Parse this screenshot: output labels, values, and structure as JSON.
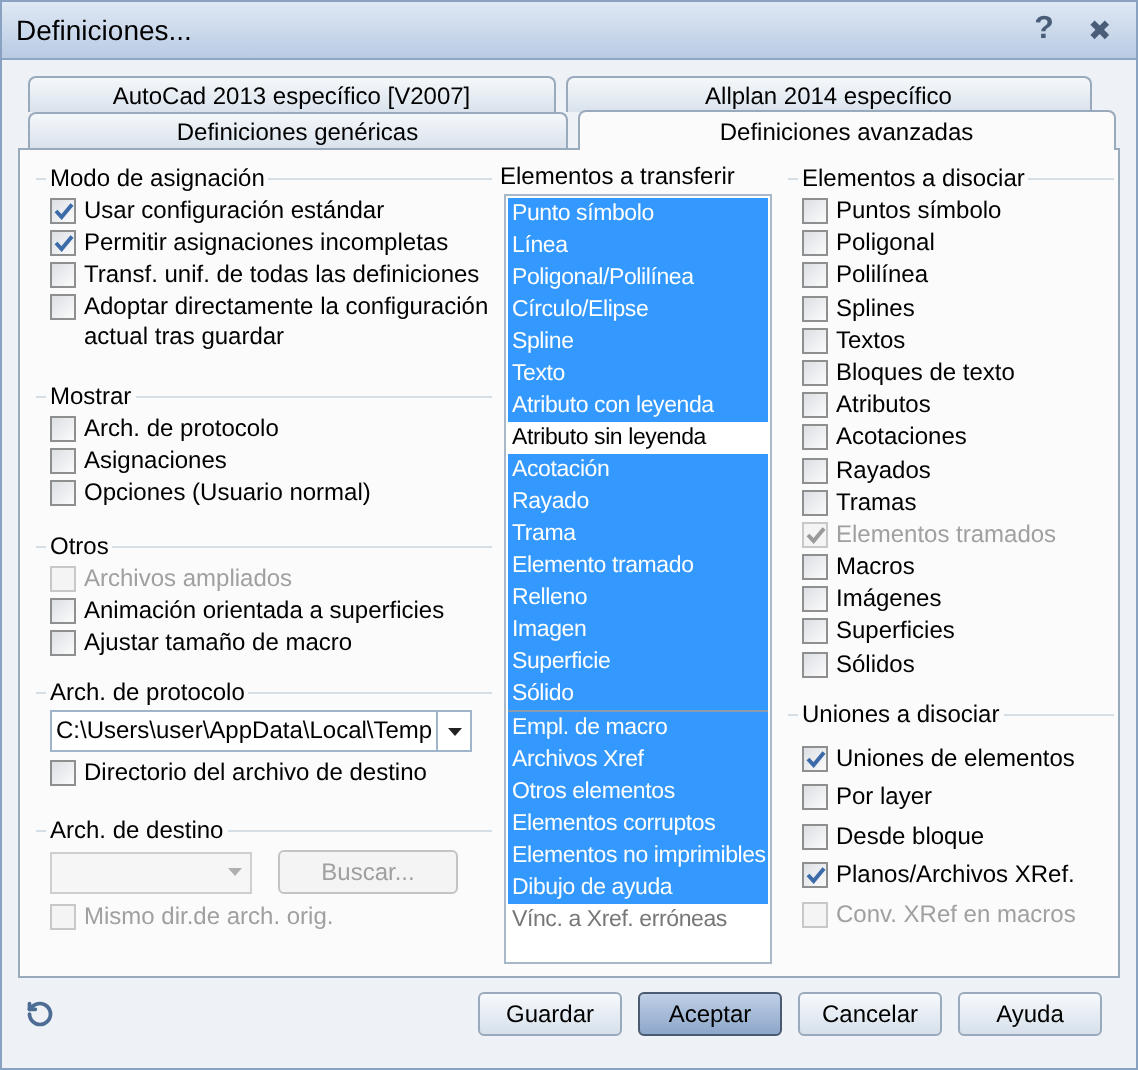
{
  "window": {
    "title": "Definiciones...",
    "help_glyph": "?",
    "close_glyph": "✖"
  },
  "tabs": [
    [
      {
        "label": "AutoCad 2013 específico [V2007]",
        "selected": false
      },
      {
        "label": "Allplan 2014 específico",
        "selected": false
      }
    ],
    [
      {
        "label": "Definiciones genéricas",
        "selected": false
      },
      {
        "label": "Definiciones avanzadas",
        "selected": true
      }
    ]
  ],
  "modo_asignacion": {
    "title": "Modo de asignación",
    "options": [
      {
        "label": "Usar configuración estándar",
        "checked": true,
        "disabled": false
      },
      {
        "label": "Permitir asignaciones incompletas",
        "checked": true,
        "disabled": false
      },
      {
        "label": "Transf. unif. de todas las definiciones",
        "checked": false,
        "disabled": false
      },
      {
        "label": "Adoptar directamente la configuración actual tras guardar",
        "checked": false,
        "disabled": false
      }
    ]
  },
  "mostrar": {
    "title": "Mostrar",
    "options": [
      {
        "label": "Arch. de protocolo",
        "checked": false,
        "disabled": false
      },
      {
        "label": "Asignaciones",
        "checked": false,
        "disabled": false
      },
      {
        "label": "Opciones (Usuario normal)",
        "checked": false,
        "disabled": false
      }
    ]
  },
  "otros": {
    "title": "Otros",
    "options": [
      {
        "label": "Archivos ampliados",
        "checked": false,
        "disabled": true
      },
      {
        "label": "Animación orientada a superficies",
        "checked": false,
        "disabled": false
      },
      {
        "label": "Ajustar tamaño de macro",
        "checked": false,
        "disabled": false
      }
    ]
  },
  "arch_protocolo": {
    "title": "Arch. de protocolo",
    "path": "C:\\Users\\user\\AppData\\Local\\Temp",
    "options": [
      {
        "label": "Directorio del archivo de destino",
        "checked": false,
        "disabled": false
      }
    ]
  },
  "arch_destino": {
    "title": "Arch. de destino",
    "combo": {
      "disabled": true
    },
    "browse_button": {
      "label": "Buscar...",
      "disabled": true
    },
    "options": [
      {
        "label": "Mismo dir.de arch. orig.",
        "checked": false,
        "disabled": true
      }
    ]
  },
  "transferir": {
    "title": "Elementos a transferir",
    "groups": [
      [
        {
          "label": "Punto símbolo",
          "selected": true
        },
        {
          "label": "Línea",
          "selected": true
        },
        {
          "label": "Poligonal/Polilínea",
          "selected": true
        },
        {
          "label": "Círculo/Elipse",
          "selected": true
        },
        {
          "label": "Spline",
          "selected": true
        },
        {
          "label": "Texto",
          "selected": true
        },
        {
          "label": "Atributo con leyenda",
          "selected": true
        },
        {
          "label": "Atributo sin leyenda",
          "selected": false
        },
        {
          "label": "Acotación",
          "selected": true
        },
        {
          "label": "Rayado",
          "selected": true
        },
        {
          "label": "Trama",
          "selected": true
        },
        {
          "label": "Elemento tramado",
          "selected": true
        },
        {
          "label": "Relleno",
          "selected": true
        },
        {
          "label": "Imagen",
          "selected": true
        },
        {
          "label": "Superficie",
          "selected": true
        },
        {
          "label": "Sólido",
          "selected": true
        }
      ],
      [
        {
          "label": "Empl. de macro",
          "selected": true
        },
        {
          "label": "Archivos Xref",
          "selected": true
        },
        {
          "label": "Otros elementos",
          "selected": true
        },
        {
          "label": "Elementos corruptos",
          "selected": true
        },
        {
          "label": "Elementos no imprimibles",
          "selected": true
        },
        {
          "label": "Dibujo de ayuda",
          "selected": true
        },
        {
          "label": "Vínc. a Xref. erróneas",
          "selected": false
        }
      ]
    ]
  },
  "disociar": {
    "title": "Elementos a disociar",
    "options": [
      {
        "label": "Puntos símbolo",
        "checked": false,
        "disabled": false
      },
      {
        "label": "Poligonal",
        "checked": false,
        "disabled": false
      },
      {
        "label": "Polilínea",
        "checked": false,
        "disabled": false
      },
      {
        "label": "Splines",
        "checked": false,
        "disabled": false
      },
      {
        "label": "Textos",
        "checked": false,
        "disabled": false
      },
      {
        "label": "Bloques de texto",
        "checked": false,
        "disabled": false
      },
      {
        "label": "Atributos",
        "checked": false,
        "disabled": false
      },
      {
        "label": "Acotaciones",
        "checked": false,
        "disabled": false
      },
      {
        "label": "Rayados",
        "checked": false,
        "disabled": false
      },
      {
        "label": "Tramas",
        "checked": false,
        "disabled": false
      },
      {
        "label": "Elementos tramados",
        "checked": true,
        "disabled": true
      },
      {
        "label": "Macros",
        "checked": false,
        "disabled": false
      },
      {
        "label": "Imágenes",
        "checked": false,
        "disabled": false
      },
      {
        "label": "Superficies",
        "checked": false,
        "disabled": false
      },
      {
        "label": "Sólidos",
        "checked": false,
        "disabled": false
      }
    ]
  },
  "uniones": {
    "title": "Uniones a disociar",
    "options": [
      {
        "label": "Uniones de elementos",
        "checked": true,
        "disabled": false
      },
      {
        "label": "Por layer",
        "checked": false,
        "disabled": false
      },
      {
        "label": "Desde bloque",
        "checked": false,
        "disabled": false
      },
      {
        "label": "Planos/Archivos XRef.",
        "checked": true,
        "disabled": false
      },
      {
        "label": "Conv. XRef en macros",
        "checked": false,
        "disabled": true
      }
    ]
  },
  "buttons": [
    {
      "label": "Guardar",
      "default": false
    },
    {
      "label": "Aceptar",
      "default": true
    },
    {
      "label": "Cancelar",
      "default": false
    },
    {
      "label": "Ayuda",
      "default": false
    }
  ]
}
